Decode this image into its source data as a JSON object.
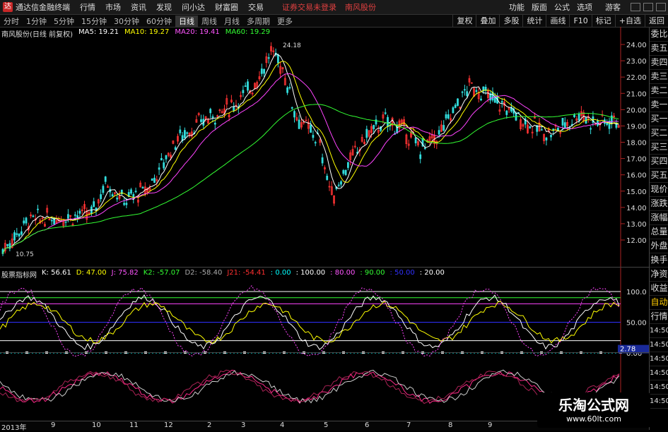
{
  "menubar": {
    "app_name": "通达信金融终端",
    "items": [
      "行情",
      "市场",
      "资讯",
      "发现",
      "问小达",
      "财富圈",
      "交易"
    ],
    "login_status": "证券交易未登录",
    "stock_name": "南风股份",
    "right_items": [
      "功能",
      "版面",
      "公式",
      "选项",
      "游客"
    ]
  },
  "toolbar": {
    "periods": [
      "分时",
      "1分钟",
      "5分钟",
      "15分钟",
      "30分钟",
      "60分钟",
      "日线",
      "周线",
      "月线",
      "多周期",
      "更多"
    ],
    "active_period": "日线",
    "right_buttons": [
      "复权",
      "叠加",
      "多股",
      "统计",
      "画线",
      "F10",
      "标记",
      "+自选",
      "返回"
    ]
  },
  "main_chart": {
    "title": "南风股份(日线 前复权)",
    "ma": [
      {
        "label": "MA5: 19.21",
        "color": "#ffffff"
      },
      {
        "label": "MA10: 19.27",
        "color": "#ffff00"
      },
      {
        "label": "MA20: 19.41",
        "color": "#ff00ff"
      },
      {
        "label": "MA60: 19.29",
        "color": "#00ff00"
      }
    ],
    "high_label": "24.18",
    "low_label": "10.75",
    "price_ticks": [
      "24.00",
      "23.00",
      "22.00",
      "21.00",
      "20.00",
      "19.00",
      "18.00",
      "17.00",
      "16.00",
      "15.00",
      "14.00",
      "13.00",
      "12.00"
    ]
  },
  "sub_chart": {
    "title": "股票指标网",
    "fields": [
      {
        "label": "K: 56.61",
        "color": "#ffffff"
      },
      {
        "label": "D: 47.00",
        "color": "#ffff00"
      },
      {
        "label": "J: 75.82",
        "color": "#ff00ff"
      },
      {
        "label": "K2: -57.07",
        "color": "#00ff00"
      },
      {
        "label": "D2: -58.40",
        "color": "#aaaaaa"
      },
      {
        "label": "J21: -54.41",
        "color": "#ff3030"
      },
      {
        "label": ": 0.00",
        "color": "#00ffff"
      },
      {
        "label": ": 100.00",
        "color": "#ffffff"
      },
      {
        "label": ": 80.00",
        "color": "#ff00ff"
      },
      {
        "label": ": 90.00",
        "color": "#00ff00"
      },
      {
        "label": ": 50.00",
        "color": "#0000ff"
      },
      {
        "label": ": 20.00",
        "color": "#ffffff"
      }
    ],
    "ticks": [
      "100.0",
      "50.00",
      "0.00"
    ],
    "marker_value": "2.78"
  },
  "right_panel": [
    "委比",
    "卖五",
    "卖四",
    "卖三",
    "卖二",
    "卖一",
    "买一",
    "买二",
    "买三",
    "买四",
    "买五",
    "现价",
    "涨跌",
    "涨幅",
    "总量",
    "外盘",
    "换手",
    "净资",
    "收益",
    "自动",
    "行情"
  ],
  "right_times": [
    "14:50",
    "14:50",
    "14:50",
    "14:50",
    "14:50",
    "14:50"
  ],
  "x_axis": [
    "2013年",
    "9",
    "10",
    "11",
    "12",
    "2",
    "3",
    "4",
    "5",
    "6",
    "7",
    "8",
    "9"
  ],
  "watermark": {
    "title": "乐淘公式网",
    "url": "www.60lt.com"
  }
}
